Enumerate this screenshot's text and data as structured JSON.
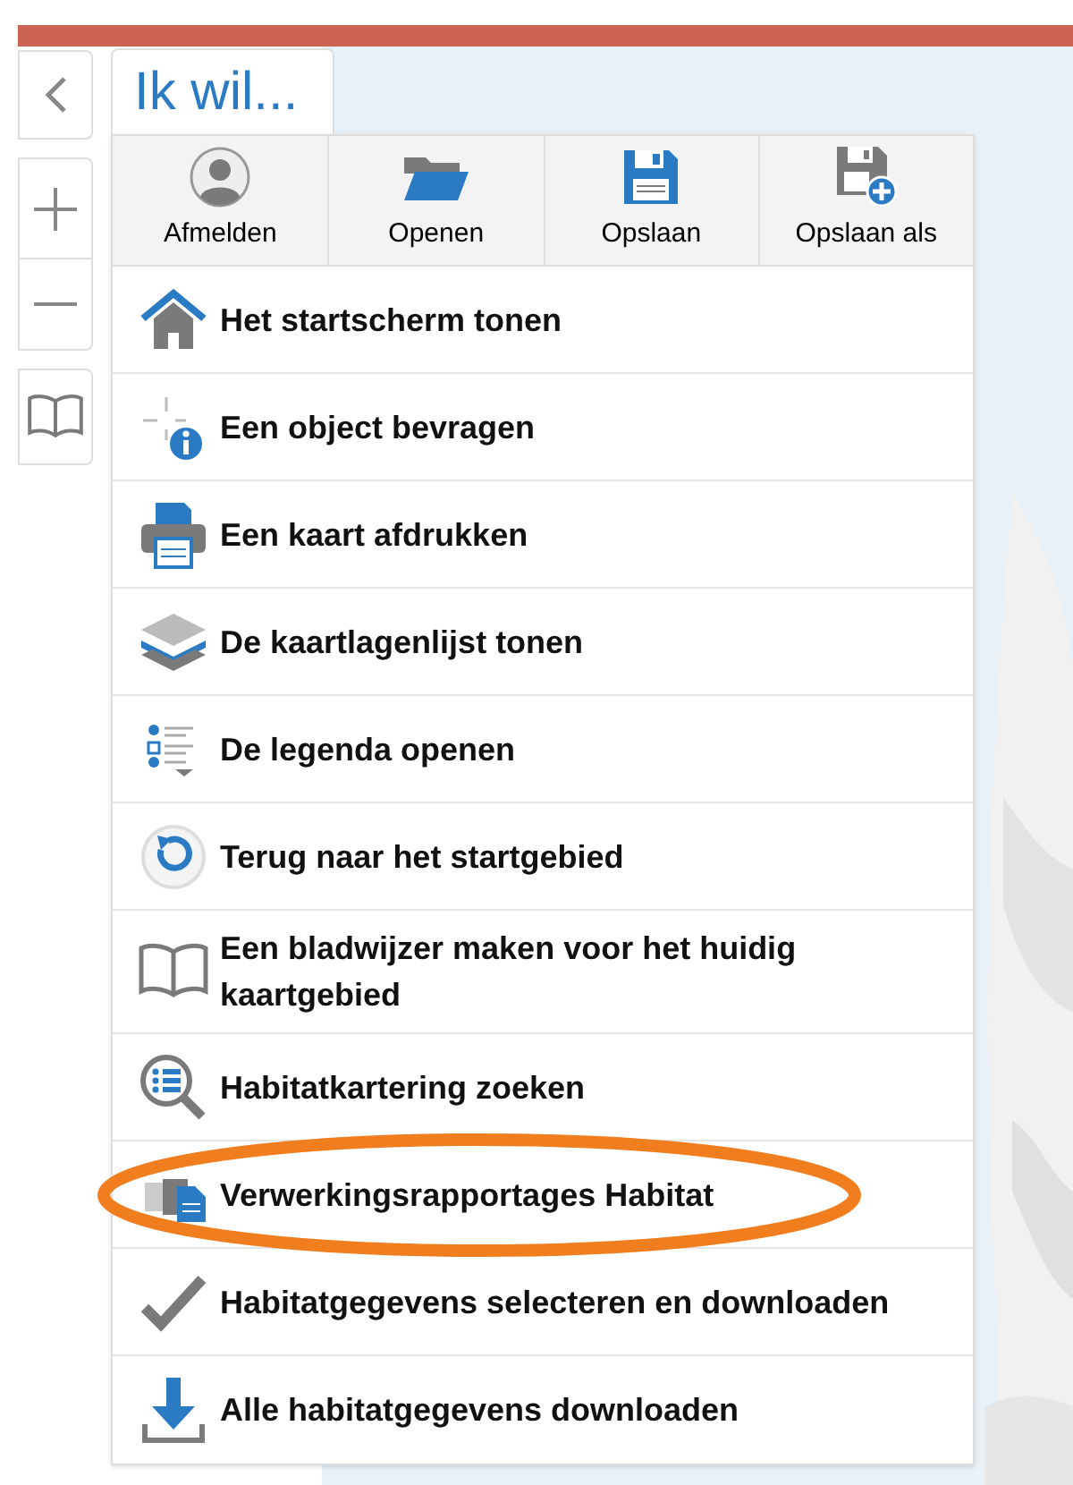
{
  "tab": {
    "label": "Ik wil...",
    "selected": true
  },
  "toolbar": [
    {
      "label": "Afmelden"
    },
    {
      "label": "Openen"
    },
    {
      "label": "Opslaan"
    },
    {
      "label": "Opslaan als"
    }
  ],
  "menu_items": [
    {
      "label": "Het startscherm tonen",
      "highlighted": false
    },
    {
      "label": "Een object bevragen",
      "highlighted": false
    },
    {
      "label": "Een kaart afdrukken",
      "highlighted": false
    },
    {
      "label": "De kaartlagenlijst tonen",
      "highlighted": false
    },
    {
      "label": "De legenda openen",
      "highlighted": false
    },
    {
      "label": "Terug naar het startgebied",
      "highlighted": false
    },
    {
      "label": "Een bladwijzer maken voor het huidig kaartgebied",
      "highlighted": false
    },
    {
      "label": "Habitatkartering zoeken",
      "highlighted": false
    },
    {
      "label": "Verwerkingsrapportages Habitat",
      "highlighted": true
    },
    {
      "label": "Habitatgegevens selecteren en downloaden",
      "highlighted": false
    },
    {
      "label": "Alle habitatgegevens downloaden",
      "highlighted": false
    }
  ]
}
